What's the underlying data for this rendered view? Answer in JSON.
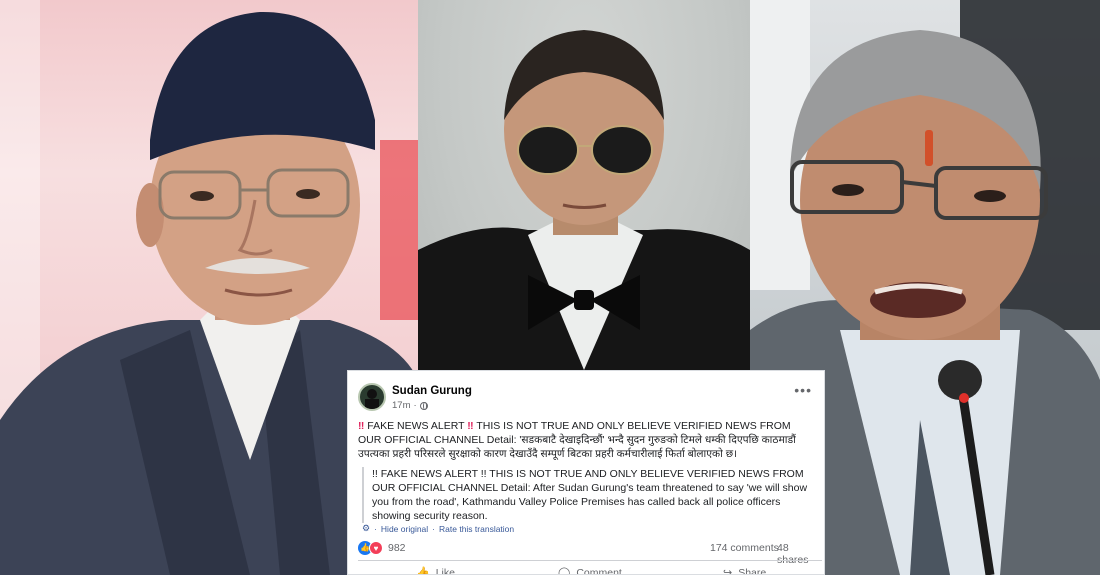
{
  "post": {
    "author": "Sudan Gurung",
    "time": "17m",
    "more_label": "•••",
    "alert_mark": "‼",
    "text_lead": " FAKE NEWS ALERT ",
    "text_main": " THIS IS NOT TRUE AND ONLY BELIEVE VERIFIED NEWS FROM OUR OFFICIAL CHANNEL Detail: 'सडकबाटै देखाइदिन्छौं' भन्दै सुदन गुरुङको टिमले धम्की दिएपछि काठमाडौं उपत्यका प्रहरी परिसरले सुरक्षाको कारण देखाउँदै सम्पूर्ण बिटका प्रहरी कर्मचारीलाई फिर्ता बोलाएको छ।",
    "translation": "!! FAKE NEWS ALERT !! THIS IS NOT TRUE AND ONLY BELIEVE VERIFIED NEWS FROM OUR OFFICIAL CHANNEL Detail: After Sudan Gurung's team threatened to say 'we will show you from the road', Kathmandu Valley Police Premises has called back all police officers showing security reason.",
    "hide_original": "Hide original",
    "rate_translation": "Rate this translation",
    "reaction_count": "982",
    "comments": "174 comments",
    "shares": "48 shares",
    "actions": {
      "like": "Like",
      "comment": "Comment",
      "share": "Share"
    }
  },
  "colors": {
    "link": "#385898",
    "like": "#1877f2",
    "love": "#f33e58",
    "alert": "#e0245e"
  }
}
